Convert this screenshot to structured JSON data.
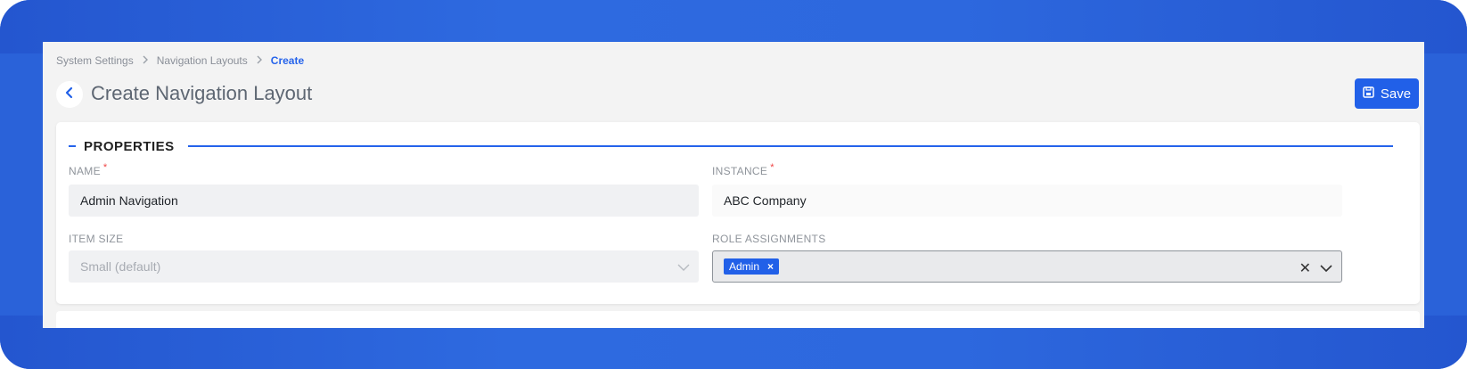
{
  "breadcrumb": {
    "items": [
      "System Settings",
      "Navigation Layouts"
    ],
    "current": "Create"
  },
  "page": {
    "title": "Create Navigation Layout",
    "save_label": "Save"
  },
  "section": {
    "title": "PROPERTIES"
  },
  "form": {
    "name": {
      "label": "NAME",
      "value": "Admin Navigation"
    },
    "instance": {
      "label": "INSTANCE",
      "value": "ABC Company"
    },
    "item_size": {
      "label": "ITEM SIZE",
      "value": "Small (default)"
    },
    "role_assignments": {
      "label": "ROLE ASSIGNMENTS",
      "tags": [
        "Admin"
      ]
    }
  },
  "colors": {
    "accent": "#2160e8",
    "required": "#ef4444"
  },
  "icons": [
    "chevron-left-icon",
    "chevron-right-icon",
    "save-icon",
    "chevron-down-icon",
    "clear-icon",
    "tag-remove-icon"
  ]
}
